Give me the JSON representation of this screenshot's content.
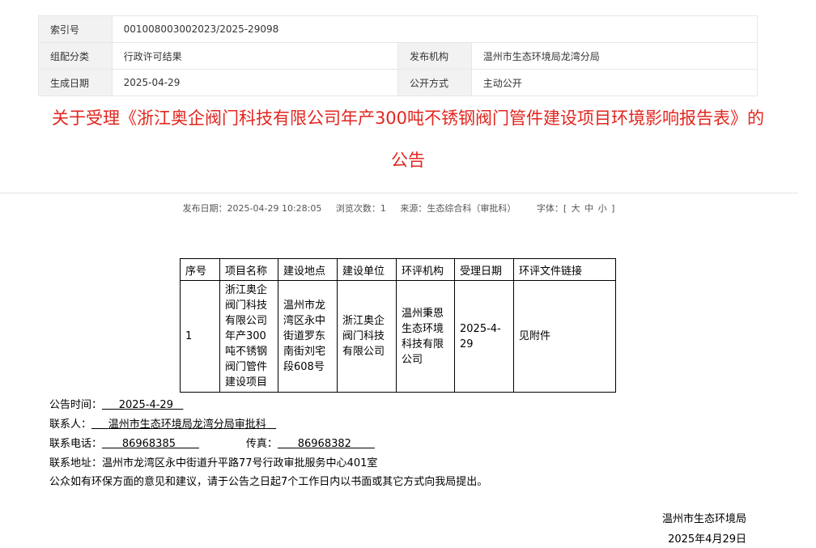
{
  "meta": {
    "index_label": "索引号",
    "index_value": "001008003002023/2025-29098",
    "category_label": "组配分类",
    "category_value": "行政许可结果",
    "issuer_label": "发布机构",
    "issuer_value": "温州市生态环境局龙湾分局",
    "date_label": "生成日期",
    "date_value": "2025-04-29",
    "mode_label": "公开方式",
    "mode_value": "主动公开"
  },
  "title": {
    "line1": "关于受理《浙江奥企阀门科技有限公司年产300吨不锈钢阀门管件建设项目环境影响报告表》的",
    "line2": "公告"
  },
  "info": {
    "publish": "发布日期：2025-04-29 10:28:05",
    "views": "浏览次数：1",
    "source": "来源：生态综合科（审批科）",
    "font_label": "字体：[",
    "font_large": "大",
    "font_medium": "中",
    "font_small": "小",
    "font_end": "]"
  },
  "table": {
    "headers": [
      "序号",
      "项目名称",
      "建设地点",
      "建设单位",
      "环评机构",
      "受理日期",
      "环评文件链接"
    ],
    "row": {
      "no": "1",
      "project": [
        "浙江奥企",
        "阀门科技",
        "有限公司",
        "年产300",
        "吨不锈钢",
        "阀门管件",
        "建设项目"
      ],
      "location": [
        "温州市龙",
        "湾区永中",
        "街道罗东",
        "南街刘宅",
        "段608号"
      ],
      "builder": [
        "浙江奥企",
        "阀门科技",
        "有限公司"
      ],
      "agency": [
        "温州秉恩",
        "生态环境",
        "科技有限",
        "公司"
      ],
      "date": [
        "2025-4-",
        "29"
      ],
      "link": "见附件"
    }
  },
  "notice": {
    "time_label": "公告时间：",
    "time_value": "2025-4-29",
    "contact_label": "联系人：",
    "contact_value": "温州市生态环境局龙湾分局审批科",
    "phone_label": "联系电话：",
    "phone_value": "86968385",
    "fax_label": "传真：",
    "fax_value": "86968382",
    "address": "联系地址：温州市龙湾区永中街道升平路77号行政审批服务中心401室",
    "note": "公众如有环保方面的意见和建议，请于公告之日起7个工作日内以书面或其它方式向我局提出。"
  },
  "signature": {
    "org": "温州市生态环境局",
    "date": "2025年4月29日"
  }
}
